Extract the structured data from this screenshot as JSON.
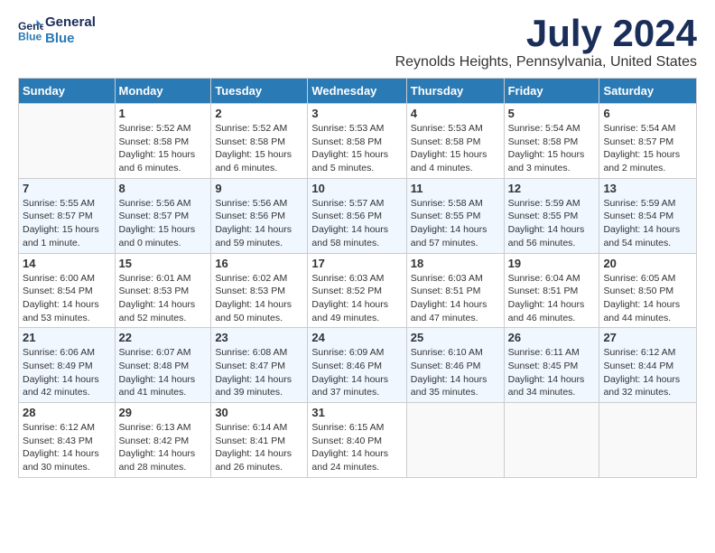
{
  "logo": {
    "line1": "General",
    "line2": "Blue"
  },
  "title": "July 2024",
  "location": "Reynolds Heights, Pennsylvania, United States",
  "days_of_week": [
    "Sunday",
    "Monday",
    "Tuesday",
    "Wednesday",
    "Thursday",
    "Friday",
    "Saturday"
  ],
  "weeks": [
    [
      {
        "day": "",
        "sunrise": "",
        "sunset": "",
        "daylight": ""
      },
      {
        "day": "1",
        "sunrise": "Sunrise: 5:52 AM",
        "sunset": "Sunset: 8:58 PM",
        "daylight": "Daylight: 15 hours and 6 minutes."
      },
      {
        "day": "2",
        "sunrise": "Sunrise: 5:52 AM",
        "sunset": "Sunset: 8:58 PM",
        "daylight": "Daylight: 15 hours and 6 minutes."
      },
      {
        "day": "3",
        "sunrise": "Sunrise: 5:53 AM",
        "sunset": "Sunset: 8:58 PM",
        "daylight": "Daylight: 15 hours and 5 minutes."
      },
      {
        "day": "4",
        "sunrise": "Sunrise: 5:53 AM",
        "sunset": "Sunset: 8:58 PM",
        "daylight": "Daylight: 15 hours and 4 minutes."
      },
      {
        "day": "5",
        "sunrise": "Sunrise: 5:54 AM",
        "sunset": "Sunset: 8:58 PM",
        "daylight": "Daylight: 15 hours and 3 minutes."
      },
      {
        "day": "6",
        "sunrise": "Sunrise: 5:54 AM",
        "sunset": "Sunset: 8:57 PM",
        "daylight": "Daylight: 15 hours and 2 minutes."
      }
    ],
    [
      {
        "day": "7",
        "sunrise": "Sunrise: 5:55 AM",
        "sunset": "Sunset: 8:57 PM",
        "daylight": "Daylight: 15 hours and 1 minute."
      },
      {
        "day": "8",
        "sunrise": "Sunrise: 5:56 AM",
        "sunset": "Sunset: 8:57 PM",
        "daylight": "Daylight: 15 hours and 0 minutes."
      },
      {
        "day": "9",
        "sunrise": "Sunrise: 5:56 AM",
        "sunset": "Sunset: 8:56 PM",
        "daylight": "Daylight: 14 hours and 59 minutes."
      },
      {
        "day": "10",
        "sunrise": "Sunrise: 5:57 AM",
        "sunset": "Sunset: 8:56 PM",
        "daylight": "Daylight: 14 hours and 58 minutes."
      },
      {
        "day": "11",
        "sunrise": "Sunrise: 5:58 AM",
        "sunset": "Sunset: 8:55 PM",
        "daylight": "Daylight: 14 hours and 57 minutes."
      },
      {
        "day": "12",
        "sunrise": "Sunrise: 5:59 AM",
        "sunset": "Sunset: 8:55 PM",
        "daylight": "Daylight: 14 hours and 56 minutes."
      },
      {
        "day": "13",
        "sunrise": "Sunrise: 5:59 AM",
        "sunset": "Sunset: 8:54 PM",
        "daylight": "Daylight: 14 hours and 54 minutes."
      }
    ],
    [
      {
        "day": "14",
        "sunrise": "Sunrise: 6:00 AM",
        "sunset": "Sunset: 8:54 PM",
        "daylight": "Daylight: 14 hours and 53 minutes."
      },
      {
        "day": "15",
        "sunrise": "Sunrise: 6:01 AM",
        "sunset": "Sunset: 8:53 PM",
        "daylight": "Daylight: 14 hours and 52 minutes."
      },
      {
        "day": "16",
        "sunrise": "Sunrise: 6:02 AM",
        "sunset": "Sunset: 8:53 PM",
        "daylight": "Daylight: 14 hours and 50 minutes."
      },
      {
        "day": "17",
        "sunrise": "Sunrise: 6:03 AM",
        "sunset": "Sunset: 8:52 PM",
        "daylight": "Daylight: 14 hours and 49 minutes."
      },
      {
        "day": "18",
        "sunrise": "Sunrise: 6:03 AM",
        "sunset": "Sunset: 8:51 PM",
        "daylight": "Daylight: 14 hours and 47 minutes."
      },
      {
        "day": "19",
        "sunrise": "Sunrise: 6:04 AM",
        "sunset": "Sunset: 8:51 PM",
        "daylight": "Daylight: 14 hours and 46 minutes."
      },
      {
        "day": "20",
        "sunrise": "Sunrise: 6:05 AM",
        "sunset": "Sunset: 8:50 PM",
        "daylight": "Daylight: 14 hours and 44 minutes."
      }
    ],
    [
      {
        "day": "21",
        "sunrise": "Sunrise: 6:06 AM",
        "sunset": "Sunset: 8:49 PM",
        "daylight": "Daylight: 14 hours and 42 minutes."
      },
      {
        "day": "22",
        "sunrise": "Sunrise: 6:07 AM",
        "sunset": "Sunset: 8:48 PM",
        "daylight": "Daylight: 14 hours and 41 minutes."
      },
      {
        "day": "23",
        "sunrise": "Sunrise: 6:08 AM",
        "sunset": "Sunset: 8:47 PM",
        "daylight": "Daylight: 14 hours and 39 minutes."
      },
      {
        "day": "24",
        "sunrise": "Sunrise: 6:09 AM",
        "sunset": "Sunset: 8:46 PM",
        "daylight": "Daylight: 14 hours and 37 minutes."
      },
      {
        "day": "25",
        "sunrise": "Sunrise: 6:10 AM",
        "sunset": "Sunset: 8:46 PM",
        "daylight": "Daylight: 14 hours and 35 minutes."
      },
      {
        "day": "26",
        "sunrise": "Sunrise: 6:11 AM",
        "sunset": "Sunset: 8:45 PM",
        "daylight": "Daylight: 14 hours and 34 minutes."
      },
      {
        "day": "27",
        "sunrise": "Sunrise: 6:12 AM",
        "sunset": "Sunset: 8:44 PM",
        "daylight": "Daylight: 14 hours and 32 minutes."
      }
    ],
    [
      {
        "day": "28",
        "sunrise": "Sunrise: 6:12 AM",
        "sunset": "Sunset: 8:43 PM",
        "daylight": "Daylight: 14 hours and 30 minutes."
      },
      {
        "day": "29",
        "sunrise": "Sunrise: 6:13 AM",
        "sunset": "Sunset: 8:42 PM",
        "daylight": "Daylight: 14 hours and 28 minutes."
      },
      {
        "day": "30",
        "sunrise": "Sunrise: 6:14 AM",
        "sunset": "Sunset: 8:41 PM",
        "daylight": "Daylight: 14 hours and 26 minutes."
      },
      {
        "day": "31",
        "sunrise": "Sunrise: 6:15 AM",
        "sunset": "Sunset: 8:40 PM",
        "daylight": "Daylight: 14 hours and 24 minutes."
      },
      {
        "day": "",
        "sunrise": "",
        "sunset": "",
        "daylight": ""
      },
      {
        "day": "",
        "sunrise": "",
        "sunset": "",
        "daylight": ""
      },
      {
        "day": "",
        "sunrise": "",
        "sunset": "",
        "daylight": ""
      }
    ]
  ]
}
